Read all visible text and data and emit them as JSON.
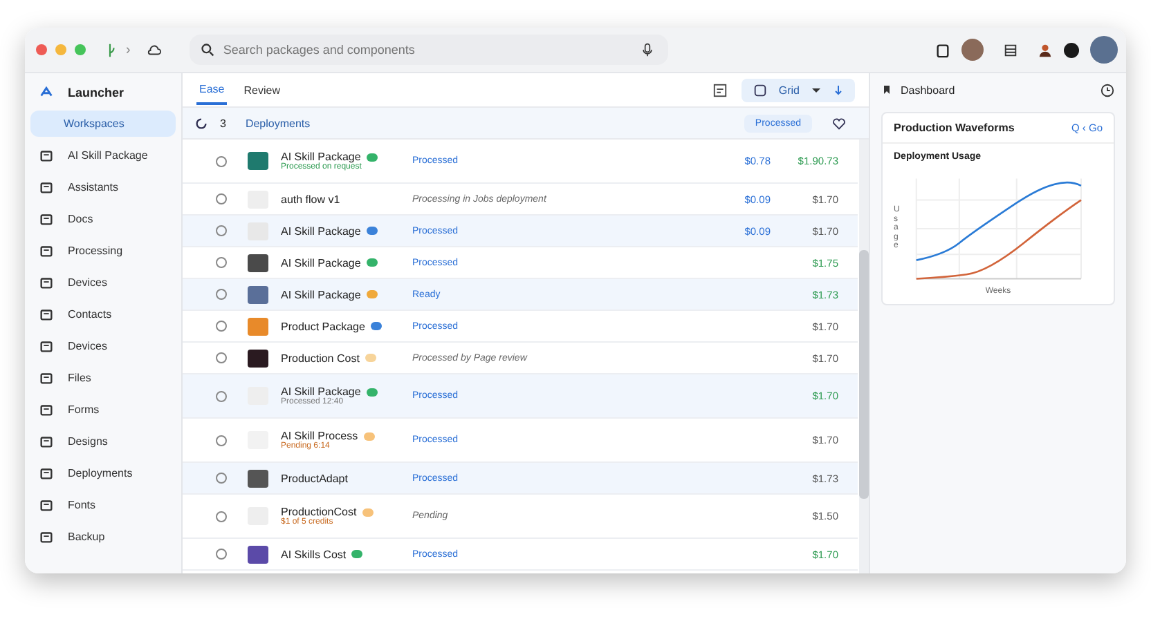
{
  "window": {
    "search": {
      "placeholder": "Search packages and components"
    },
    "breadcrumb": "›"
  },
  "sidebar": {
    "title": "Launcher",
    "items": [
      {
        "label": "Workspaces",
        "selected": true
      },
      {
        "label": "AI Skill Package",
        "selected": false
      },
      {
        "label": "Assistants",
        "selected": false
      },
      {
        "label": "Docs",
        "selected": false
      },
      {
        "label": "Processing",
        "selected": false
      },
      {
        "label": "Devices",
        "selected": false
      },
      {
        "label": "Contacts",
        "selected": false
      },
      {
        "label": "Devices",
        "selected": false
      },
      {
        "label": "Files",
        "selected": false
      },
      {
        "label": "Forms",
        "selected": false
      },
      {
        "label": "Designs",
        "selected": false
      },
      {
        "label": "Deployments",
        "selected": false
      },
      {
        "label": "Fonts",
        "selected": false
      },
      {
        "label": "Backup",
        "selected": false
      }
    ]
  },
  "tabs": [
    {
      "label": "Ease",
      "selected": true
    },
    {
      "label": "Review",
      "selected": false
    }
  ],
  "toolbar": {
    "view": "Grid"
  },
  "list_header": {
    "count": "3",
    "title": "Deployments",
    "filter": "Processed"
  },
  "rows": [
    {
      "title": "AI Skill Package",
      "sub": {
        "text": "Processed on request",
        "kind": "ok"
      },
      "badge": {
        "color": "#34b36a"
      },
      "thumb": {
        "color": "#1f7a6e"
      },
      "status": "Processed",
      "price": "$0.78",
      "total": {
        "text": "$1.90.73",
        "kind": "ok"
      },
      "selected": false
    },
    {
      "title": "auth flow v1",
      "thumb": {
        "color": "#eeeeee"
      },
      "note": "Processing in Jobs deployment",
      "price": "$0.09",
      "total": {
        "text": "$1.70",
        "kind": "plain"
      },
      "selected": false
    },
    {
      "title": "AI Skill Package",
      "badge": {
        "color": "#3b82d9"
      },
      "thumb": {
        "color": "#e8e8e8"
      },
      "status": "Processed",
      "price": "$0.09",
      "total": {
        "text": "$1.70",
        "kind": "plain"
      },
      "selected": true
    },
    {
      "title": "AI Skill Package",
      "badge": {
        "color": "#34b36a"
      },
      "thumb": {
        "color": "#4a4a4a"
      },
      "status": "Processed",
      "total": {
        "text": "$1.75",
        "kind": "ok"
      },
      "selected": false
    },
    {
      "title": "AI Skill Package",
      "badge": {
        "color": "#f0a93b"
      },
      "thumb": {
        "color": "#5a6f99"
      },
      "status": "Ready",
      "total": {
        "text": "$1.73",
        "kind": "ok"
      },
      "selected": true
    },
    {
      "title": "Product Package",
      "badge": {
        "color": "#3b82d9"
      },
      "thumb": {
        "color": "#e88a2a"
      },
      "status": "Processed",
      "total": {
        "text": "$1.70",
        "kind": "plain"
      },
      "selected": false
    },
    {
      "title": "Production Cost",
      "badge": {
        "color": "#f7d49a"
      },
      "thumb": {
        "color": "#2a1a20"
      },
      "note": "Processed by Page review",
      "total": {
        "text": "$1.70",
        "kind": "plain"
      },
      "selected": false
    },
    {
      "title": "AI Skill Package",
      "sub": {
        "text": "Processed 12:40",
        "kind": "plain"
      },
      "badge": {
        "color": "#34b36a"
      },
      "thumb": {
        "color": "#eeeeee"
      },
      "status": "Processed",
      "total": {
        "text": "$1.70",
        "kind": "ok"
      },
      "selected": true
    },
    {
      "title": "AI Skill Process",
      "sub": {
        "text": "Pending 6:14",
        "kind": "warn"
      },
      "badge": {
        "color": "#f7c27a"
      },
      "thumb": {
        "color": "#f2f2f2"
      },
      "status": "Processed",
      "total": {
        "text": "$1.70",
        "kind": "plain"
      },
      "selected": false
    },
    {
      "title": "ProductAdapt",
      "thumb": {
        "color": "#555555"
      },
      "status": "Processed",
      "total": {
        "text": "$1.73",
        "kind": "plain"
      },
      "selected": true
    },
    {
      "title": "ProductionCost",
      "sub": {
        "text": "$1 of 5 credits",
        "kind": "warn"
      },
      "badge": {
        "color": "#f7c27a"
      },
      "thumb": {
        "color": "#eeeeee"
      },
      "note": "Pending",
      "total": {
        "text": "$1.50",
        "kind": "plain"
      },
      "selected": false
    },
    {
      "title": "AI Skills Cost",
      "badge": {
        "color": "#34b36a"
      },
      "thumb": {
        "color": "#5b4aa8"
      },
      "status": "Processed",
      "total": {
        "text": "$1.70",
        "kind": "ok"
      },
      "selected": false
    }
  ],
  "right_panel": {
    "title": "Dashboard",
    "card_title": "Production Waveforms",
    "card_link": "Q ‹ Go",
    "chart_title": "Deployment Usage",
    "x_axis": "Weeks",
    "y_axis": "Usage"
  }
}
